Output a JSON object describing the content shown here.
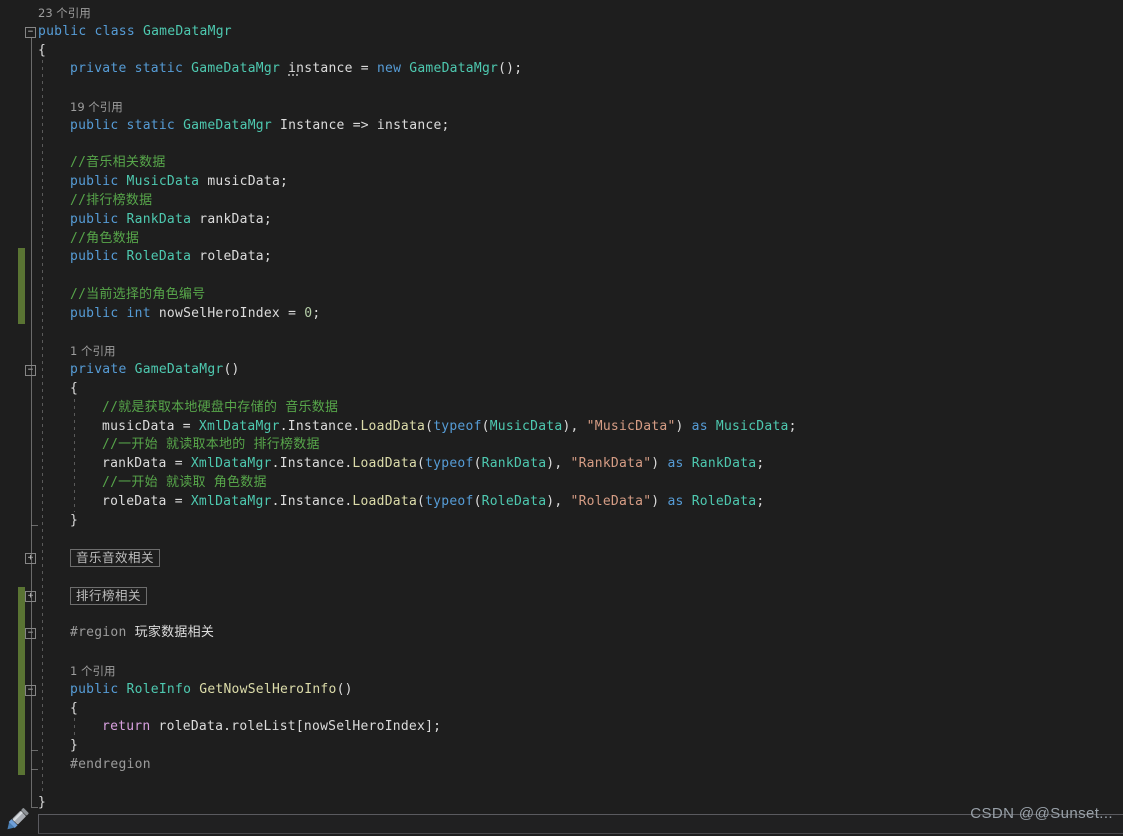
{
  "watermark": {
    "text": "CSDN @@Sunset..."
  },
  "colors": {
    "background": "#1e1e1e",
    "text": "#dcdcdc",
    "keyword": "#569cd6",
    "type": "#4ec9b0",
    "comment": "#57a64a",
    "string": "#d69d85",
    "number": "#b5cea8",
    "control": "#d8a0df",
    "preprocessor": "#9b9b9b",
    "method": "#dcdcaa",
    "codelens": "#9d9d9d",
    "guide": "#5a5a5a",
    "fold": "#858585",
    "change_bar": "#5a7433",
    "watermark": "#98a0a8"
  },
  "code": {
    "rows": [
      {
        "kind": "lens",
        "indent": 0,
        "text": "23 个引用"
      },
      {
        "kind": "code",
        "indent": 0,
        "fold": "open",
        "tokens": [
          {
            "c": "kw",
            "t": "public "
          },
          {
            "c": "kw",
            "t": "class "
          },
          {
            "c": "ty",
            "t": "GameDataMgr"
          }
        ]
      },
      {
        "kind": "code",
        "indent": 0,
        "tokens": [
          {
            "c": "pl",
            "t": "{"
          }
        ]
      },
      {
        "kind": "code",
        "indent": 1,
        "tokens": [
          {
            "c": "kw",
            "t": "private "
          },
          {
            "c": "kw",
            "t": "static "
          },
          {
            "c": "ty",
            "t": "GameDataMgr "
          },
          {
            "c": "pl dots",
            "t": "instance"
          },
          {
            "c": "pl",
            "t": " = "
          },
          {
            "c": "kw",
            "t": "new "
          },
          {
            "c": "ty",
            "t": "GameDataMgr"
          },
          {
            "c": "pl",
            "t": "();"
          }
        ]
      },
      {
        "kind": "blank"
      },
      {
        "kind": "lens",
        "indent": 1,
        "text": "19 个引用"
      },
      {
        "kind": "code",
        "indent": 1,
        "tokens": [
          {
            "c": "kw",
            "t": "public "
          },
          {
            "c": "kw",
            "t": "static "
          },
          {
            "c": "ty",
            "t": "GameDataMgr "
          },
          {
            "c": "pl",
            "t": "Instance => instance;"
          }
        ]
      },
      {
        "kind": "blank"
      },
      {
        "kind": "code",
        "indent": 1,
        "tokens": [
          {
            "c": "cm",
            "t": "//音乐相关数据"
          }
        ]
      },
      {
        "kind": "code",
        "indent": 1,
        "tokens": [
          {
            "c": "kw",
            "t": "public "
          },
          {
            "c": "ty",
            "t": "MusicData "
          },
          {
            "c": "pl",
            "t": "musicData;"
          }
        ]
      },
      {
        "kind": "code",
        "indent": 1,
        "tokens": [
          {
            "c": "cm",
            "t": "//排行榜数据"
          }
        ]
      },
      {
        "kind": "code",
        "indent": 1,
        "tokens": [
          {
            "c": "kw",
            "t": "public "
          },
          {
            "c": "ty",
            "t": "RankData "
          },
          {
            "c": "pl",
            "t": "rankData;"
          }
        ]
      },
      {
        "kind": "code",
        "indent": 1,
        "tokens": [
          {
            "c": "cm",
            "t": "//角色数据"
          }
        ]
      },
      {
        "kind": "code",
        "indent": 1,
        "tokens": [
          {
            "c": "kw",
            "t": "public "
          },
          {
            "c": "ty",
            "t": "RoleData "
          },
          {
            "c": "pl",
            "t": "roleData;"
          }
        ]
      },
      {
        "kind": "blank"
      },
      {
        "kind": "code",
        "indent": 1,
        "tokens": [
          {
            "c": "cm",
            "t": "//当前选择的角色编号"
          }
        ]
      },
      {
        "kind": "code",
        "indent": 1,
        "tokens": [
          {
            "c": "kw",
            "t": "public "
          },
          {
            "c": "kw",
            "t": "int "
          },
          {
            "c": "pl",
            "t": "nowSelHeroIndex = "
          },
          {
            "c": "nm",
            "t": "0"
          },
          {
            "c": "pl",
            "t": ";"
          }
        ]
      },
      {
        "kind": "blank"
      },
      {
        "kind": "lens",
        "indent": 1,
        "text": "1 个引用"
      },
      {
        "kind": "code",
        "indent": 1,
        "fold": "open",
        "tokens": [
          {
            "c": "kw",
            "t": "private "
          },
          {
            "c": "ty",
            "t": "GameDataMgr"
          },
          {
            "c": "pl",
            "t": "()"
          }
        ]
      },
      {
        "kind": "code",
        "indent": 1,
        "tokens": [
          {
            "c": "pl",
            "t": "{"
          }
        ]
      },
      {
        "kind": "code",
        "indent": 2,
        "tokens": [
          {
            "c": "cm",
            "t": "//就是获取本地硬盘中存储的 音乐数据"
          }
        ]
      },
      {
        "kind": "code",
        "indent": 2,
        "tokens": [
          {
            "c": "pl",
            "t": "musicData = "
          },
          {
            "c": "ty",
            "t": "XmlDataMgr"
          },
          {
            "c": "pl",
            "t": ".Instance."
          },
          {
            "c": "mt",
            "t": "LoadData"
          },
          {
            "c": "pl",
            "t": "("
          },
          {
            "c": "kw",
            "t": "typeof"
          },
          {
            "c": "pl",
            "t": "("
          },
          {
            "c": "ty",
            "t": "MusicData"
          },
          {
            "c": "pl",
            "t": "), "
          },
          {
            "c": "st",
            "t": "\"MusicData\""
          },
          {
            "c": "pl",
            "t": ") "
          },
          {
            "c": "kw",
            "t": "as "
          },
          {
            "c": "ty",
            "t": "MusicData"
          },
          {
            "c": "pl",
            "t": ";"
          }
        ]
      },
      {
        "kind": "code",
        "indent": 2,
        "tokens": [
          {
            "c": "cm",
            "t": "//一开始 就读取本地的 排行榜数据"
          }
        ]
      },
      {
        "kind": "code",
        "indent": 2,
        "tokens": [
          {
            "c": "pl",
            "t": "rankData = "
          },
          {
            "c": "ty",
            "t": "XmlDataMgr"
          },
          {
            "c": "pl",
            "t": ".Instance."
          },
          {
            "c": "mt",
            "t": "LoadData"
          },
          {
            "c": "pl",
            "t": "("
          },
          {
            "c": "kw",
            "t": "typeof"
          },
          {
            "c": "pl",
            "t": "("
          },
          {
            "c": "ty",
            "t": "RankData"
          },
          {
            "c": "pl",
            "t": "), "
          },
          {
            "c": "st",
            "t": "\"RankData\""
          },
          {
            "c": "pl",
            "t": ") "
          },
          {
            "c": "kw",
            "t": "as "
          },
          {
            "c": "ty",
            "t": "RankData"
          },
          {
            "c": "pl",
            "t": ";"
          }
        ]
      },
      {
        "kind": "code",
        "indent": 2,
        "tokens": [
          {
            "c": "cm",
            "t": "//一开始 就读取 角色数据"
          }
        ]
      },
      {
        "kind": "code",
        "indent": 2,
        "tokens": [
          {
            "c": "pl",
            "t": "roleData = "
          },
          {
            "c": "ty",
            "t": "XmlDataMgr"
          },
          {
            "c": "pl",
            "t": ".Instance."
          },
          {
            "c": "mt",
            "t": "LoadData"
          },
          {
            "c": "pl",
            "t": "("
          },
          {
            "c": "kw",
            "t": "typeof"
          },
          {
            "c": "pl",
            "t": "("
          },
          {
            "c": "ty",
            "t": "RoleData"
          },
          {
            "c": "pl",
            "t": "), "
          },
          {
            "c": "st",
            "t": "\"RoleData\""
          },
          {
            "c": "pl",
            "t": ") "
          },
          {
            "c": "kw",
            "t": "as "
          },
          {
            "c": "ty",
            "t": "RoleData"
          },
          {
            "c": "pl",
            "t": ";"
          }
        ]
      },
      {
        "kind": "code",
        "indent": 1,
        "tokens": [
          {
            "c": "pl",
            "t": "}"
          }
        ]
      },
      {
        "kind": "blank"
      },
      {
        "kind": "region",
        "indent": 1,
        "fold": "closed",
        "text": "音乐音效相关"
      },
      {
        "kind": "blank"
      },
      {
        "kind": "region",
        "indent": 1,
        "fold": "closed",
        "text": "排行榜相关"
      },
      {
        "kind": "blank"
      },
      {
        "kind": "code",
        "indent": 1,
        "fold": "open",
        "tokens": [
          {
            "c": "pp",
            "t": "#region "
          },
          {
            "c": "pl",
            "t": "玩家数据相关"
          }
        ]
      },
      {
        "kind": "blank"
      },
      {
        "kind": "lens",
        "indent": 1,
        "text": "1 个引用"
      },
      {
        "kind": "code",
        "indent": 1,
        "fold": "open",
        "tokens": [
          {
            "c": "kw",
            "t": "public "
          },
          {
            "c": "ty",
            "t": "RoleInfo "
          },
          {
            "c": "mt",
            "t": "GetNowSelHeroInfo"
          },
          {
            "c": "pl",
            "t": "()"
          }
        ]
      },
      {
        "kind": "code",
        "indent": 1,
        "tokens": [
          {
            "c": "pl",
            "t": "{"
          }
        ]
      },
      {
        "kind": "code",
        "indent": 2,
        "tokens": [
          {
            "c": "ct",
            "t": "return "
          },
          {
            "c": "pl",
            "t": "roleData.roleList[nowSelHeroIndex];"
          }
        ]
      },
      {
        "kind": "code",
        "indent": 1,
        "tokens": [
          {
            "c": "pl",
            "t": "}"
          }
        ]
      },
      {
        "kind": "code",
        "indent": 1,
        "tokens": [
          {
            "c": "pp",
            "t": "#endregion"
          }
        ]
      },
      {
        "kind": "blank"
      },
      {
        "kind": "code",
        "indent": 0,
        "tokens": [
          {
            "c": "pl",
            "t": "}"
          }
        ]
      }
    ]
  },
  "margin": {
    "change_bars": [
      {
        "from_row": 13,
        "to_row": 16
      },
      {
        "from_row": 31,
        "to_row": 40
      }
    ],
    "fold_line": {
      "from_row": 1,
      "to_row": 42
    },
    "fold_end_ticks": [
      27,
      39,
      40,
      42
    ],
    "indent_guides": [
      {
        "level": 1,
        "from_row": 3,
        "to_row": 42
      },
      {
        "level": 2,
        "from_row": 21,
        "to_row": 27
      },
      {
        "level": 2,
        "from_row": 38,
        "to_row": 39
      }
    ]
  }
}
